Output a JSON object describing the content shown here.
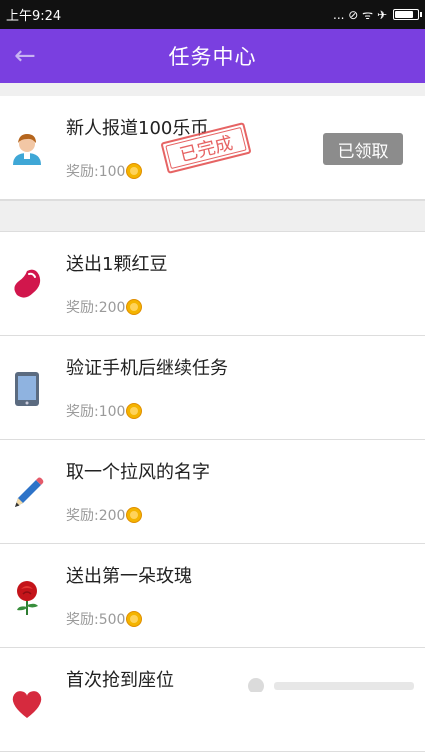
{
  "status_bar": {
    "time": "上午9:24",
    "indicators": "... ⊘ ᯤ ✈"
  },
  "app_bar": {
    "title": "任务中心",
    "back_icon": "arrow-left-icon"
  },
  "tasks": [
    {
      "name": "新人报道100乐币",
      "reward_label": "奖励:100",
      "icon": "avatar-icon",
      "completed_stamp": "已完成",
      "button": "已领取"
    },
    {
      "name": "送出1颗红豆",
      "reward_label": "奖励:200",
      "icon": "red-bean-icon"
    },
    {
      "name": "验证手机后继续任务",
      "reward_label": "奖励:100",
      "icon": "phone-icon"
    },
    {
      "name": "取一个拉风的名字",
      "reward_label": "奖励:200",
      "icon": "pencil-icon"
    },
    {
      "name": "送出第一朵玫瑰",
      "reward_label": "奖励:500",
      "icon": "rose-icon"
    },
    {
      "name": "首次抢到座位",
      "icon": "heart-icon"
    }
  ],
  "colors": {
    "accent": "#7a3fe0",
    "claimed_button": "#8c8c8c",
    "stamp": "#e24a4a",
    "coin": "#f4b400"
  }
}
